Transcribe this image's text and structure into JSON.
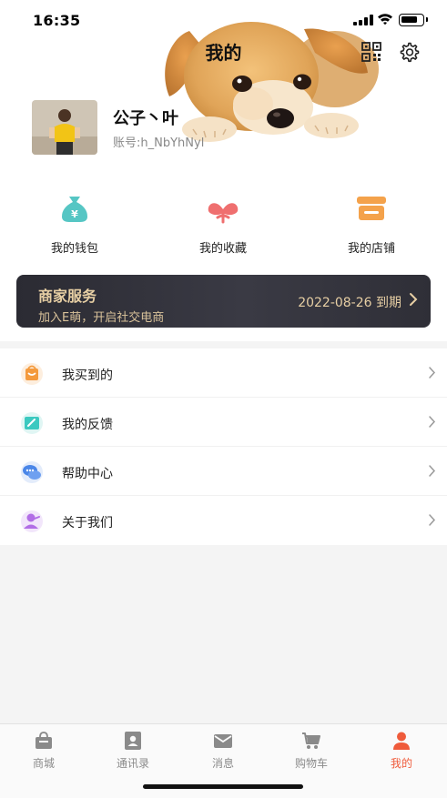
{
  "status_bar": {
    "time": "16:35",
    "battery_level": 0.8
  },
  "header": {
    "title": "我的",
    "qr_icon": "qr-code-icon",
    "settings_icon": "gear-icon"
  },
  "profile": {
    "name": "公子丶叶",
    "account": "账号:h_NbYhNyl"
  },
  "quick_actions": [
    {
      "label": "我的钱包",
      "icon": "wallet-icon",
      "color": "#56c6c4"
    },
    {
      "label": "我的收藏",
      "icon": "heart-icon",
      "color": "#ef6f6f"
    },
    {
      "label": "我的店铺",
      "icon": "store-icon",
      "color": "#f4a24b"
    }
  ],
  "merchant": {
    "title": "商家服务",
    "subtitle": "加入E萌，开启社交电商",
    "expiry": "2022-08-26 到期"
  },
  "menu": [
    {
      "label": "我买到的",
      "icon": "shopping-bag-icon",
      "color": "#f49a3d"
    },
    {
      "label": "我的反馈",
      "icon": "edit-icon",
      "color": "#3bc9c0"
    },
    {
      "label": "帮助中心",
      "icon": "chat-bubble-icon",
      "color": "#4a86e8"
    },
    {
      "label": "关于我们",
      "icon": "person-icon",
      "color": "#b26ee6"
    }
  ],
  "tabbar": {
    "items": [
      {
        "label": "商城",
        "icon": "shop-icon"
      },
      {
        "label": "通讯录",
        "icon": "contacts-icon"
      },
      {
        "label": "消息",
        "icon": "mail-icon"
      },
      {
        "label": "购物车",
        "icon": "cart-icon"
      },
      {
        "label": "我的",
        "icon": "user-icon"
      }
    ],
    "active_index": 4,
    "active_color": "#ef5b3b",
    "inactive_color": "#8a8a8a"
  }
}
